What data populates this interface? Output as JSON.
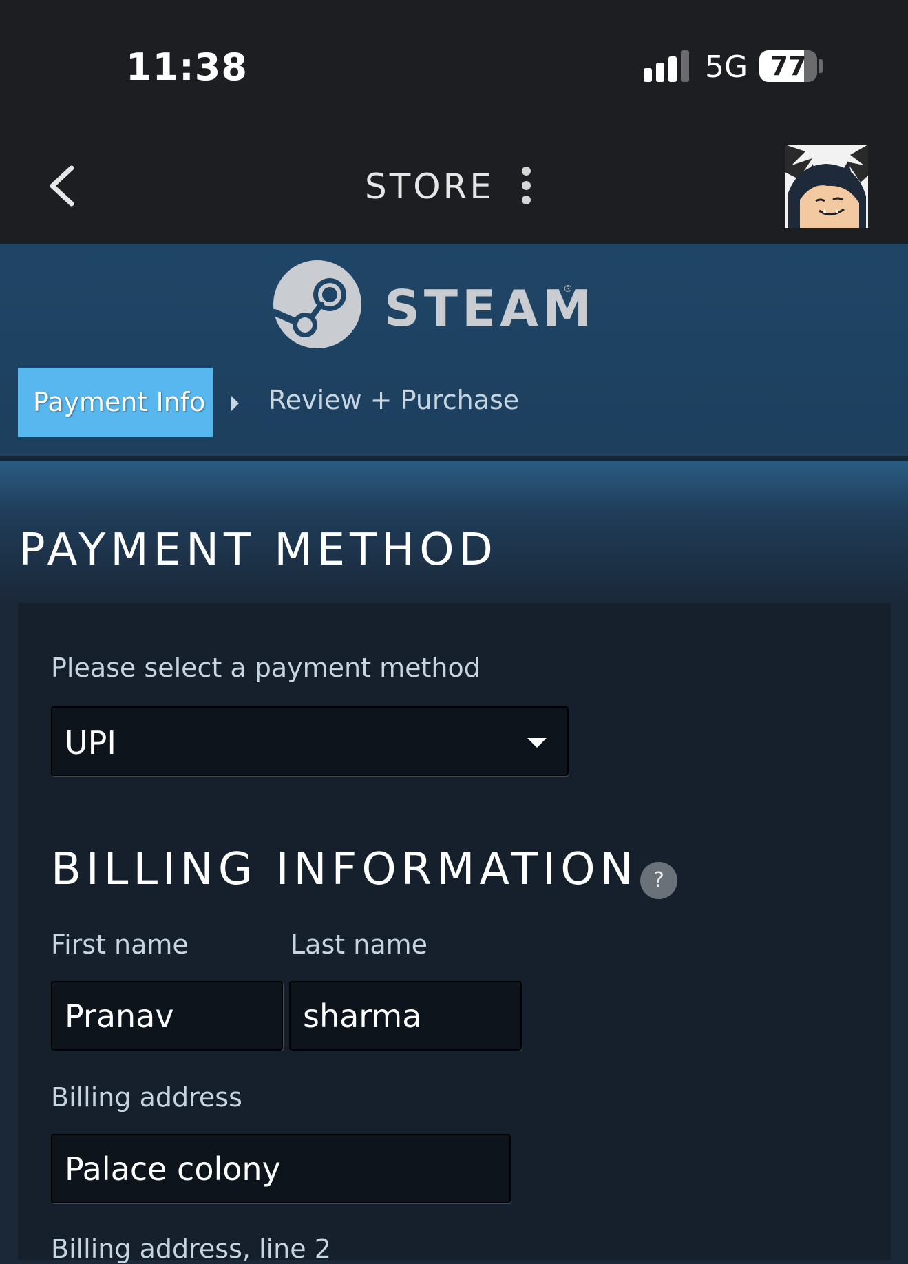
{
  "status_bar": {
    "time": "11:38",
    "network": "5G",
    "battery": "77",
    "battery_level": 0.77
  },
  "nav": {
    "title": "STORE"
  },
  "header": {
    "brand": "STEAM",
    "reg_mark": "®",
    "steps": {
      "active": "Payment Info",
      "next": "Review + Purchase"
    }
  },
  "payment": {
    "title": "PAYMENT METHOD",
    "select_label": "Please select a payment method",
    "selected_method": "UPI"
  },
  "billing": {
    "title": "BILLING INFORMATION",
    "help": "?",
    "first_name_label": "First name",
    "first_name_value": "Pranav",
    "last_name_label": "Last name",
    "last_name_value": "sharma",
    "address_label": "Billing address",
    "address_value": "Palace colony",
    "address2_label": "Billing address, line 2"
  },
  "colors": {
    "accent": "#57b7ee",
    "header_bg": "#1f4566",
    "page_bg": "#1b2838",
    "panel_bg": "#16202d",
    "input_bg": "#0e141b"
  }
}
